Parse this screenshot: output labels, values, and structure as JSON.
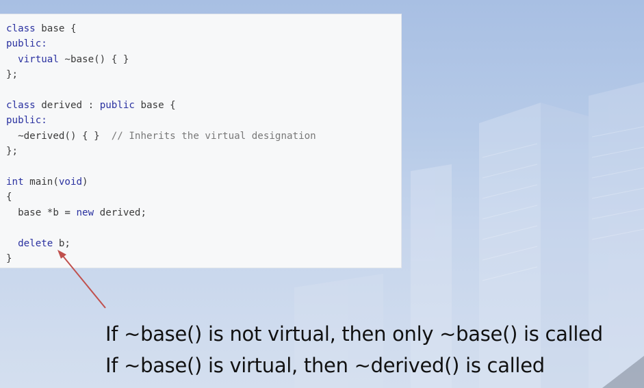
{
  "code": {
    "lines": [
      [
        {
          "t": "class",
          "k": "kw"
        },
        {
          "t": " base {",
          "k": "tx"
        }
      ],
      [
        {
          "t": "public:",
          "k": "kw"
        }
      ],
      [
        {
          "t": "  ",
          "k": "tx"
        },
        {
          "t": "virtual",
          "k": "kw"
        },
        {
          "t": " ~base() { }",
          "k": "tx"
        }
      ],
      [
        {
          "t": "};",
          "k": "tx"
        }
      ],
      [],
      [
        {
          "t": "class",
          "k": "kw"
        },
        {
          "t": " derived : ",
          "k": "tx"
        },
        {
          "t": "public",
          "k": "kw"
        },
        {
          "t": " base {",
          "k": "tx"
        }
      ],
      [
        {
          "t": "public:",
          "k": "kw"
        }
      ],
      [
        {
          "t": "  ~derived() { }  ",
          "k": "tx"
        },
        {
          "t": "// Inherits the virtual designation",
          "k": "cm"
        }
      ],
      [
        {
          "t": "};",
          "k": "tx"
        }
      ],
      [],
      [
        {
          "t": "int",
          "k": "kw"
        },
        {
          "t": " main(",
          "k": "tx"
        },
        {
          "t": "void",
          "k": "kw"
        },
        {
          "t": ")",
          "k": "tx"
        }
      ],
      [
        {
          "t": "{",
          "k": "tx"
        }
      ],
      [
        {
          "t": "  base *b = ",
          "k": "tx"
        },
        {
          "t": "new",
          "k": "kw"
        },
        {
          "t": " derived;",
          "k": "tx"
        }
      ],
      [],
      [
        {
          "t": "  ",
          "k": "tx"
        },
        {
          "t": "delete",
          "k": "kw"
        },
        {
          "t": " b;",
          "k": "tx"
        }
      ],
      [
        {
          "t": "}",
          "k": "tx"
        }
      ]
    ]
  },
  "caption": {
    "line1": "If ~base() is not virtual, then only ~base() is called",
    "line2": "If ~base() is virtual, then ~derived() is called"
  },
  "colors": {
    "keyword": "#2a31a0",
    "comment": "#787878",
    "text": "#3a3a3a",
    "arrow": "#c0504d"
  }
}
